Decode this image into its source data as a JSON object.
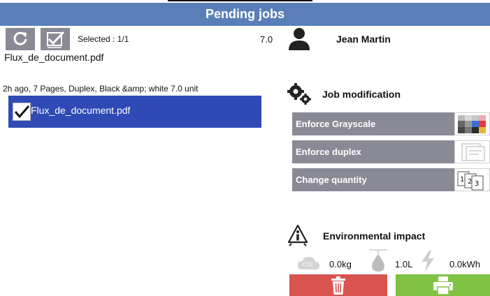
{
  "header": {
    "title": "Pending jobs"
  },
  "toolbar": {
    "refresh_icon": "refresh-icon",
    "select_all_icon": "select-all-icon",
    "selected_label": "Selected : 1/1",
    "total_cost": "7.0"
  },
  "user": {
    "name": "Jean Martin",
    "icon": "user-icon"
  },
  "document": {
    "name": "Flux_de_document.pdf",
    "meta": "2h ago,  7 Pages,  Duplex,  Black &amp; white  7.0  unit",
    "selected": true,
    "item_label": "Flux_de_document.pdf"
  },
  "job_modification": {
    "title": "Job modification",
    "icon": "gears-icon",
    "options": [
      {
        "label": "Enforce Grayscale",
        "thumb_icon": "color-swatches-icon"
      },
      {
        "label": "Enforce duplex",
        "thumb_icon": "duplex-pages-icon"
      },
      {
        "label": "Change quantity",
        "thumb_icon": "quantity-pages-icon"
      }
    ]
  },
  "environmental_impact": {
    "title": "Environmental impact",
    "icon": "recycle-info-icon",
    "co2_label": "CO2",
    "co2": "0.0kg",
    "water": "1.0L",
    "energy": "0.0kWh"
  },
  "actions": {
    "delete_icon": "trash-icon",
    "print_icon": "printer-icon"
  },
  "colors": {
    "header": "#5a7fb8",
    "tool_button": "#8a8a96",
    "selected_item": "#2f49b5",
    "delete": "#d9534f",
    "print": "#7fc241"
  }
}
